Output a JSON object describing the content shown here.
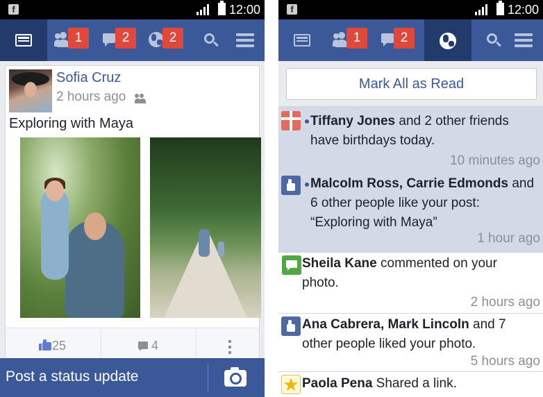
{
  "left": {
    "status": {
      "time": "12:00",
      "app_icon": "facebook-icon"
    },
    "nav": {
      "items": [
        {
          "icon": "news-feed-icon"
        },
        {
          "icon": "friend-requests-icon",
          "badge": "1"
        },
        {
          "icon": "messages-icon",
          "badge": "2"
        },
        {
          "icon": "notifications-globe-icon",
          "badge": "2"
        },
        {
          "icon": "search-icon"
        },
        {
          "icon": "menu-icon"
        }
      ]
    },
    "post": {
      "author": "Sofia Cruz",
      "time": "2 hours ago",
      "text": "Exploring with Maya",
      "likes": "25",
      "comments": "4"
    },
    "composer": {
      "label": "Post a status update"
    }
  },
  "right": {
    "status": {
      "time": "12:00"
    },
    "nav": {
      "badges": {
        "friends": "1",
        "messages": "2"
      }
    },
    "mark_all_label": "Mark All as Read",
    "notifications": [
      {
        "icon": "gift-icon",
        "bold": "Tiffany Jones",
        "rest": " and 2 other friends have birthdays today.",
        "time": "10 minutes ago",
        "unread": true
      },
      {
        "icon": "like-icon",
        "bold": "Malcolm Ross, Carrie Edmonds",
        "rest": " and 6 other people like your post: “Exploring with Maya”",
        "time": "1 hour ago",
        "unread": true
      },
      {
        "icon": "comment-icon",
        "bold": "Sheila Kane",
        "rest": " commented on your photo.",
        "time": "2 hours ago",
        "unread": false
      },
      {
        "icon": "like-icon",
        "bold": "Ana Cabrera, Mark Lincoln",
        "rest": " and 7 other people liked your photo.",
        "time": "5 hours ago",
        "unread": false
      },
      {
        "icon": "star-icon",
        "bold": "Paola Pena",
        "rest": " Shared a link.",
        "time": "",
        "unread": false
      }
    ]
  },
  "colors": {
    "brand": "#3b5998",
    "badge": "#e0483c",
    "unread_bg": "#d3d9e6"
  }
}
